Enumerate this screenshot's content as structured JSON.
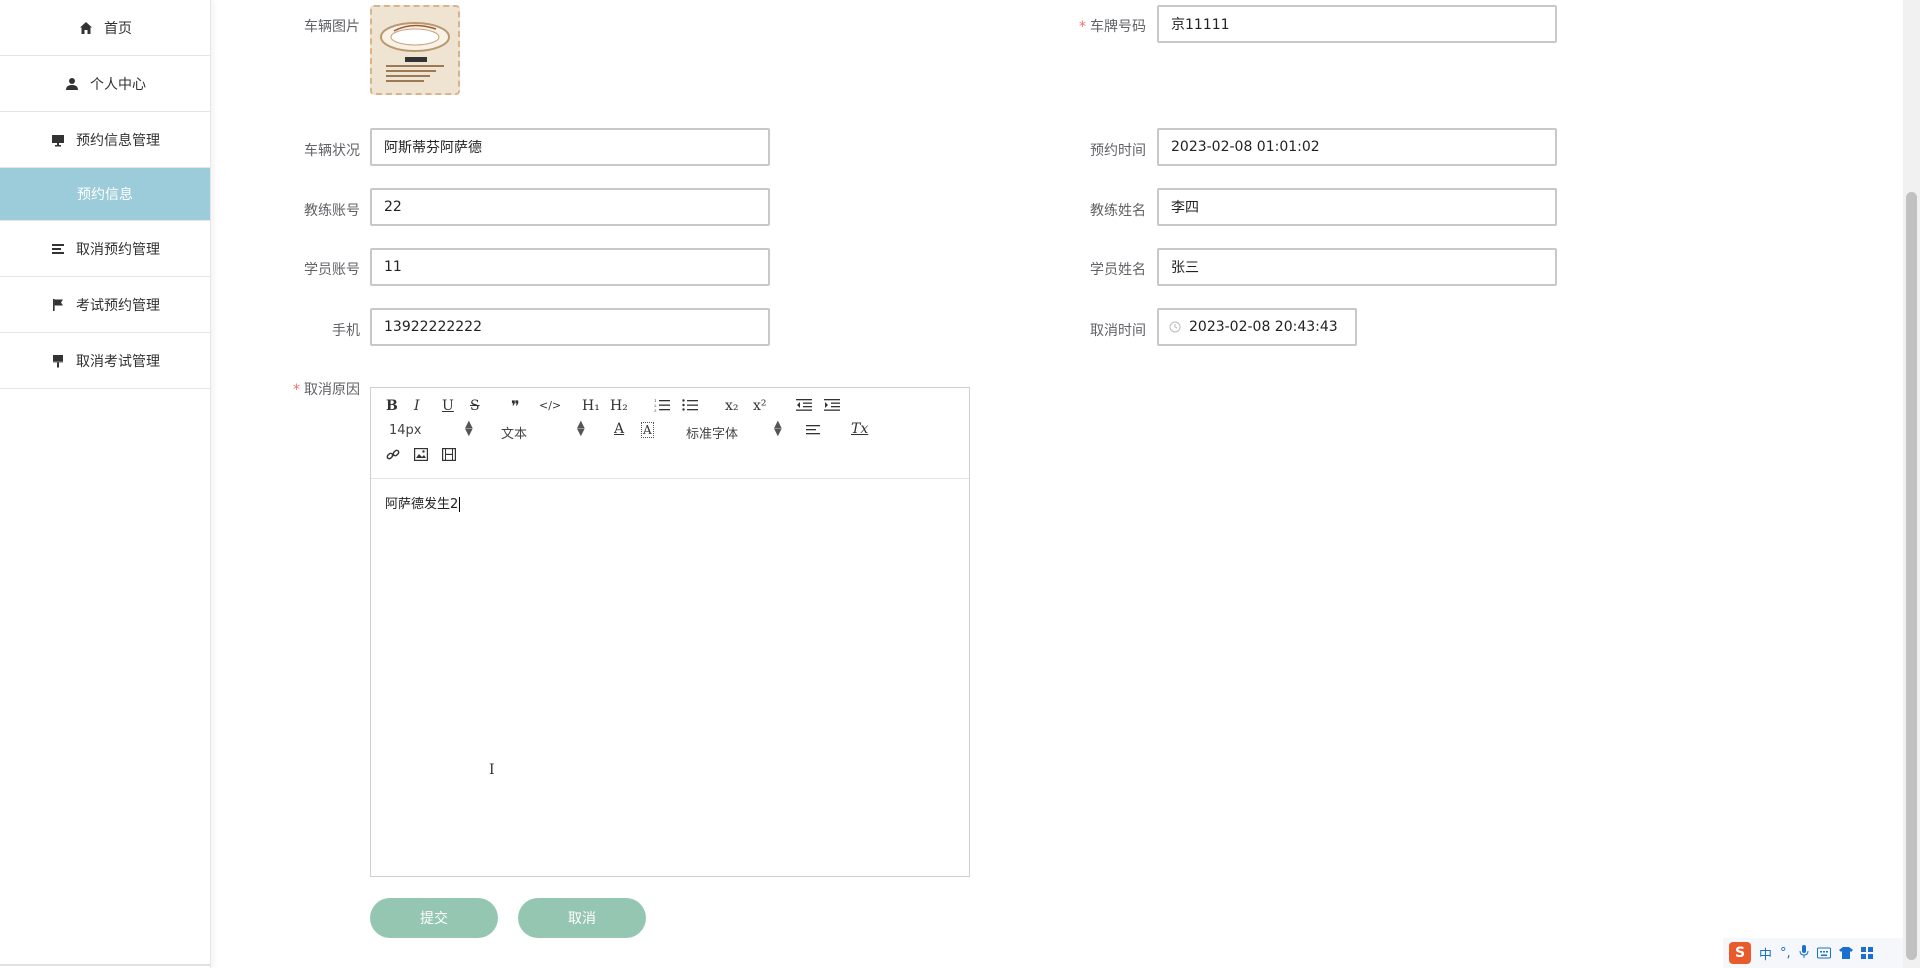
{
  "sidebar": {
    "items": [
      {
        "label": "首页",
        "icon": "home-icon"
      },
      {
        "label": "个人中心",
        "icon": "user-icon"
      },
      {
        "label": "预约信息管理",
        "icon": "monitor-icon"
      },
      {
        "label": "预约信息",
        "icon": ""
      },
      {
        "label": "取消预约管理",
        "icon": "list-icon"
      },
      {
        "label": "考试预约管理",
        "icon": "flag-icon"
      },
      {
        "label": "取消考试管理",
        "icon": "brush-icon"
      }
    ],
    "active_color": "#9ccbd9"
  },
  "form": {
    "vehicle_image_label": "车辆图片",
    "plate_label": "车牌号码",
    "plate_value": "京11111",
    "vehicle_status_label": "车辆状况",
    "vehicle_status_value": "阿斯蒂芬阿萨德",
    "reserve_time_label": "预约时间",
    "reserve_time_value": "2023-02-08 01:01:02",
    "coach_account_label": "教练账号",
    "coach_account_value": "22",
    "coach_name_label": "教练姓名",
    "coach_name_value": "李四",
    "student_account_label": "学员账号",
    "student_account_value": "11",
    "student_name_label": "学员姓名",
    "student_name_value": "张三",
    "phone_label": "手机",
    "phone_value": "13922222222",
    "cancel_time_label": "取消时间",
    "cancel_time_value": "2023-02-08 20:43:43",
    "reason_label": "取消原因",
    "required_mark": "*"
  },
  "editor": {
    "font_size": "14px",
    "text_style": "文本",
    "font_family": "标准字体",
    "content": "阿萨德发生2",
    "tools": {
      "bold": "B",
      "italic": "I",
      "underline": "U",
      "strike": "S",
      "quote": "❞",
      "code": "</>",
      "h1": "H₁",
      "h2": "H₂",
      "sub": "x₂",
      "sup": "x²",
      "clear": "Tx"
    }
  },
  "buttons": {
    "submit": "提交",
    "cancel": "取消",
    "color": "#94c6b2"
  },
  "ime": {
    "brand": "S",
    "mode": "中"
  }
}
